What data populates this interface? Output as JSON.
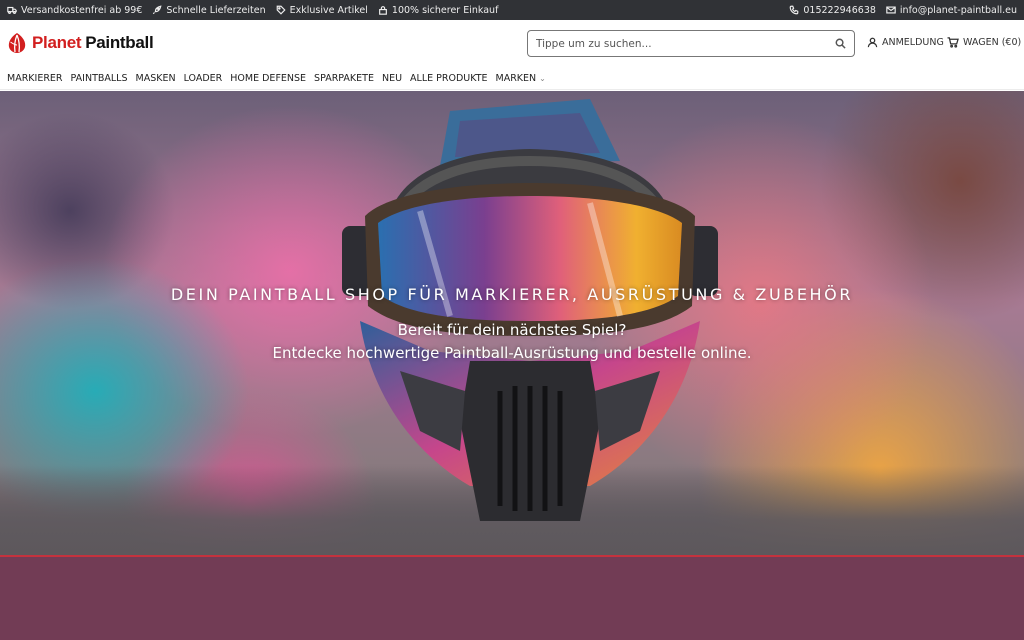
{
  "topbar": {
    "left_items": [
      {
        "icon": "truck-icon",
        "label": "Versandkostenfrei ab 99€"
      },
      {
        "icon": "rocket-icon",
        "label": "Schnelle Lieferzeiten"
      },
      {
        "icon": "tag-icon",
        "label": "Exklusive Artikel"
      },
      {
        "icon": "lock-icon",
        "label": "100% sicherer Einkauf"
      }
    ],
    "phone": "015222946638",
    "email": "info@planet-paintball.eu"
  },
  "header": {
    "logo_word1": "Planet",
    "logo_word2": "Paintball",
    "search_placeholder": "Tippe um zu suchen...",
    "account_label": "ANMELDUNG",
    "cart_label": "WAGEN (€0)"
  },
  "nav": {
    "items": [
      "MARKIERER",
      "PAINTBALLS",
      "MASKEN",
      "LOADER",
      "HOME DEFENSE",
      "SPARPAKETE",
      "NEU",
      "ALLE PRODUKTE",
      "MARKEN"
    ]
  },
  "hero": {
    "title": "DEIN PAINTBALL SHOP FÜR MARKIERER, AUSRÜSTUNG & ZUBEHÖR",
    "subtitle_line1": "Bereit für dein nächstes Spiel?",
    "subtitle_line2": "Entdecke hochwertige Paintball-Ausrüstung und bestelle online."
  },
  "colors": {
    "topbar_bg": "#303236",
    "brand_red": "#d21f1f",
    "section_bg": "#723c55",
    "hero_line": "#c4323d"
  }
}
